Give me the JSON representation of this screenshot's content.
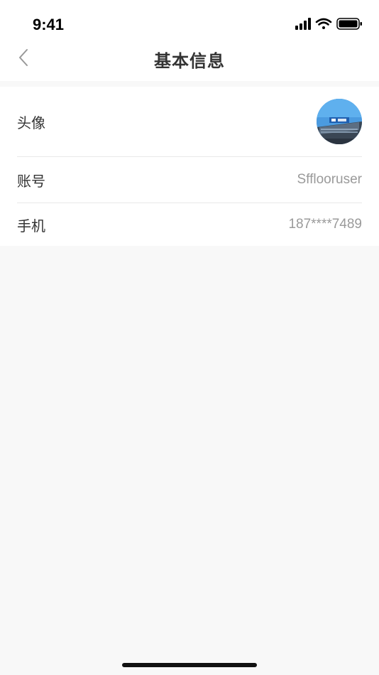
{
  "status_bar": {
    "time": "9:41",
    "icons": [
      "cellular-signal-icon",
      "wifi-icon",
      "battery-icon"
    ]
  },
  "nav": {
    "title": "基本信息",
    "back_icon": "chevron-left-icon"
  },
  "profile": {
    "avatar_label": "头像",
    "account_label": "账号",
    "account_value": "Sfflooruser",
    "phone_label": "手机",
    "phone_value": "187****7489"
  },
  "colors": {
    "background": "#f8f8f8",
    "card": "#ffffff",
    "text_primary": "#333333",
    "text_secondary": "#9a9a9a",
    "divider": "#e8e8e8"
  }
}
